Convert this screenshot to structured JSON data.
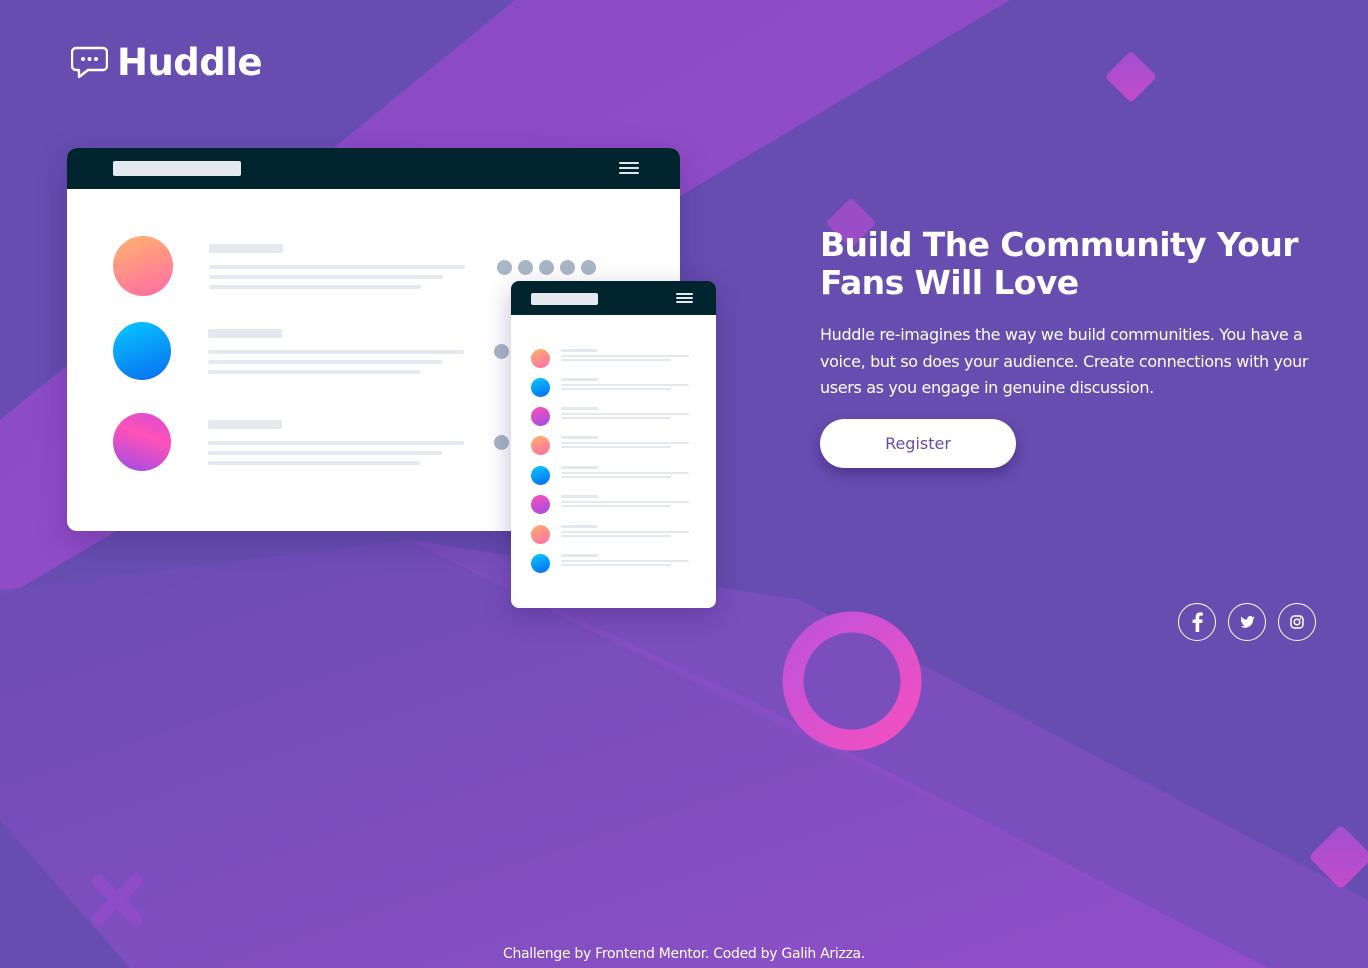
{
  "brand": {
    "name": "Huddle",
    "logo_icon": "speech-bubble-icon"
  },
  "colors": {
    "background": "#674db0",
    "accent_light": "#9a4fce",
    "accent_pink": "#f050c4",
    "mockup_bar": "#00252e",
    "button_text": "#674db0"
  },
  "hero": {
    "title_line1": "Build The Community Your",
    "title_line2": "Fans Will Love",
    "description": "Huddle re-imagines the way we build communities. You have a voice, but so does your audience. Create connections with your users as you engage in genuine discussion.",
    "cta_label": "Register"
  },
  "social": {
    "items": [
      {
        "name": "facebook",
        "icon": "facebook-icon"
      },
      {
        "name": "twitter",
        "icon": "twitter-icon"
      },
      {
        "name": "instagram",
        "icon": "instagram-icon"
      }
    ]
  },
  "footer": {
    "prefix": "Challenge by",
    "link1": "Frontend Mentor",
    "middle": ". Coded by",
    "link2": "Galih Arizza",
    "suffix": "."
  }
}
